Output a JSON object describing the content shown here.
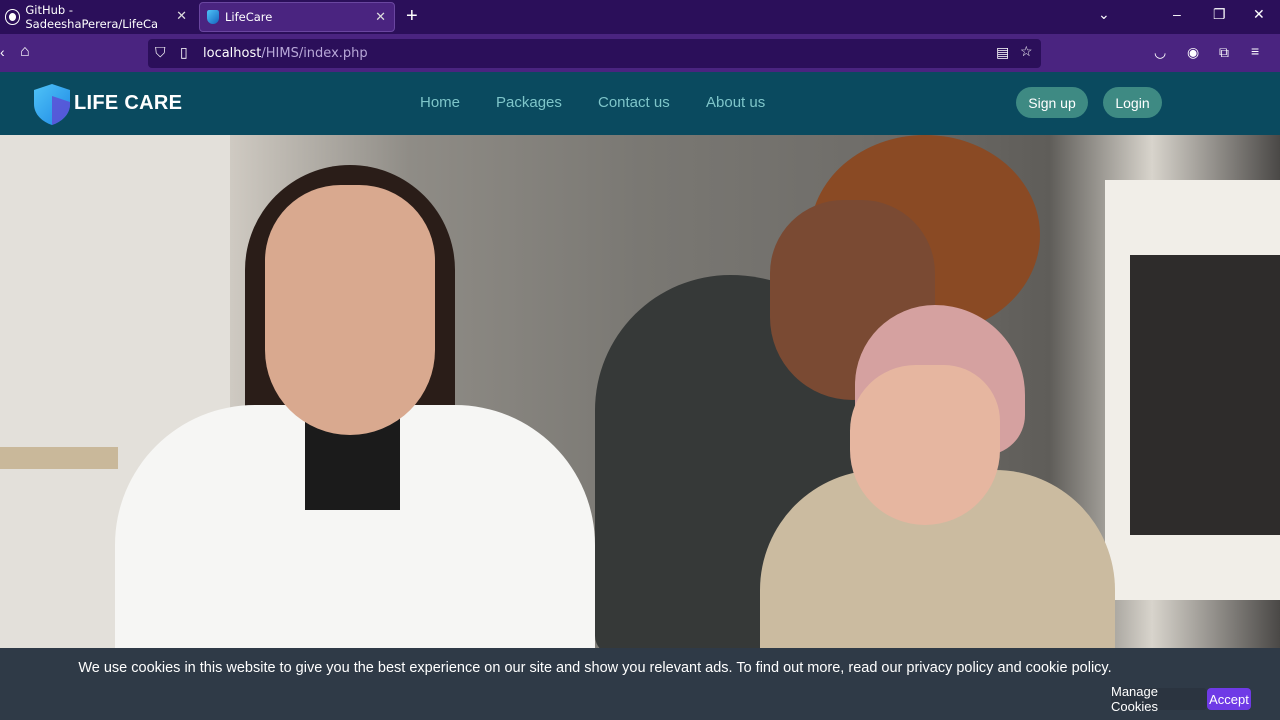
{
  "browser": {
    "tabs": [
      {
        "title": "GitHub - SadeeshaPerera/LifeCa",
        "icon": "github-icon"
      },
      {
        "title": "LifeCare",
        "icon": "lifecare-shield-icon",
        "active": true
      }
    ],
    "url_host": "localhost",
    "url_path": "/HIMS/index.php"
  },
  "site": {
    "brand": "LIFE CARE",
    "nav": [
      "Home",
      "Packages",
      "Contact us",
      "About us"
    ],
    "signup_label": "Sign up",
    "login_label": "Login"
  },
  "cookie": {
    "message": "We use cookies in this website to give you the best experience on our site and show you relevant ads. To find out more, read our privacy policy and cookie policy.",
    "manage_label": "Manage Cookies",
    "accept_label": "Accept"
  },
  "colors": {
    "header_bg": "#0a4a5f",
    "nav_link": "#7ec5c9",
    "pill_button": "#3e8a83",
    "accept_button": "#6f3ae6",
    "cookie_bg": "#2f3a47"
  }
}
